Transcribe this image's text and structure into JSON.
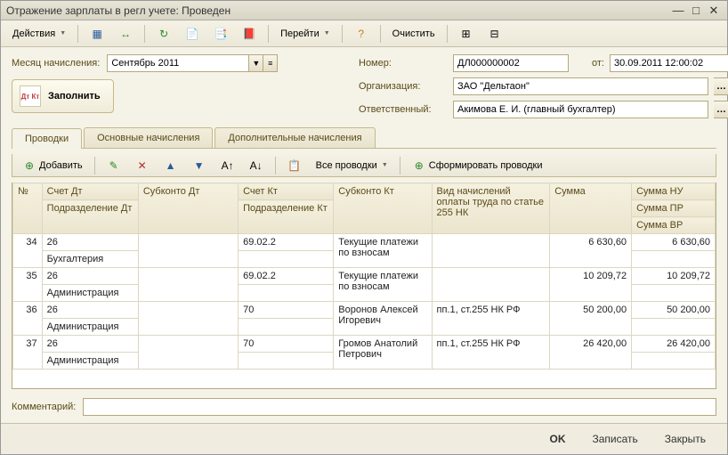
{
  "window": {
    "title": "Отражение зарплаты в регл учете: Проведен"
  },
  "toolbar": {
    "actions": "Действия",
    "goto": "Перейти",
    "clear": "Очистить"
  },
  "form": {
    "month_label": "Месяц начисления:",
    "month_value": "Сентябрь 2011",
    "fill_btn": "Заполнить",
    "number_label": "Номер:",
    "number_value": "ДЛ000000002",
    "from_label": "от:",
    "date_value": "30.09.2011 12:00:02",
    "org_label": "Организация:",
    "org_value": "ЗАО \"Дельтаон\"",
    "resp_label": "Ответственный:",
    "resp_value": "Акимова Е. И. (главный бухгалтер)"
  },
  "tabs": [
    "Проводки",
    "Основные начисления",
    "Дополнительные начисления"
  ],
  "subbar": {
    "add": "Добавить",
    "all": "Все проводки",
    "form_entries": "Сформировать проводки"
  },
  "grid": {
    "headers": {
      "n": "№",
      "dt_acc": "Счет Дт",
      "dt_sub": "Субконто Дт",
      "kt_acc": "Счет Кт",
      "kt_sub": "Субконто Кт",
      "calc_type": "Вид начислений оплаты труда по статье 255 НК",
      "sum": "Сумма",
      "sum_nu": "Сумма НУ",
      "dt_dept": "Подразделение Дт",
      "kt_dept": "Подразделение Кт",
      "sum_pr": "Сумма ПР",
      "sum_vr": "Сумма ВР"
    },
    "rows": [
      {
        "n": "34",
        "dt_acc": "26",
        "dt_dept": "Бухгалтерия",
        "kt_acc": "69.02.2",
        "kt_sub": "Текущие платежи по взносам",
        "calc": "",
        "sum": "6 630,60",
        "sum_nu": "6 630,60"
      },
      {
        "n": "35",
        "dt_acc": "26",
        "dt_dept": "Администрация",
        "kt_acc": "69.02.2",
        "kt_sub": "Текущие платежи по взносам",
        "calc": "",
        "sum": "10 209,72",
        "sum_nu": "10 209,72"
      },
      {
        "n": "36",
        "dt_acc": "26",
        "dt_dept": "Администрация",
        "kt_acc": "70",
        "kt_sub": "Воронов Алексей Игоревич",
        "calc": "пп.1, ст.255 НК РФ",
        "sum": "50 200,00",
        "sum_nu": "50 200,00"
      },
      {
        "n": "37",
        "dt_acc": "26",
        "dt_dept": "Администрация",
        "kt_acc": "70",
        "kt_sub": "Громов Анатолий Петрович",
        "calc": "пп.1, ст.255 НК РФ",
        "sum": "26 420,00",
        "sum_nu": "26 420,00"
      }
    ]
  },
  "comment_label": "Комментарий:",
  "buttons": {
    "ok": "OK",
    "save": "Записать",
    "close": "Закрыть"
  }
}
